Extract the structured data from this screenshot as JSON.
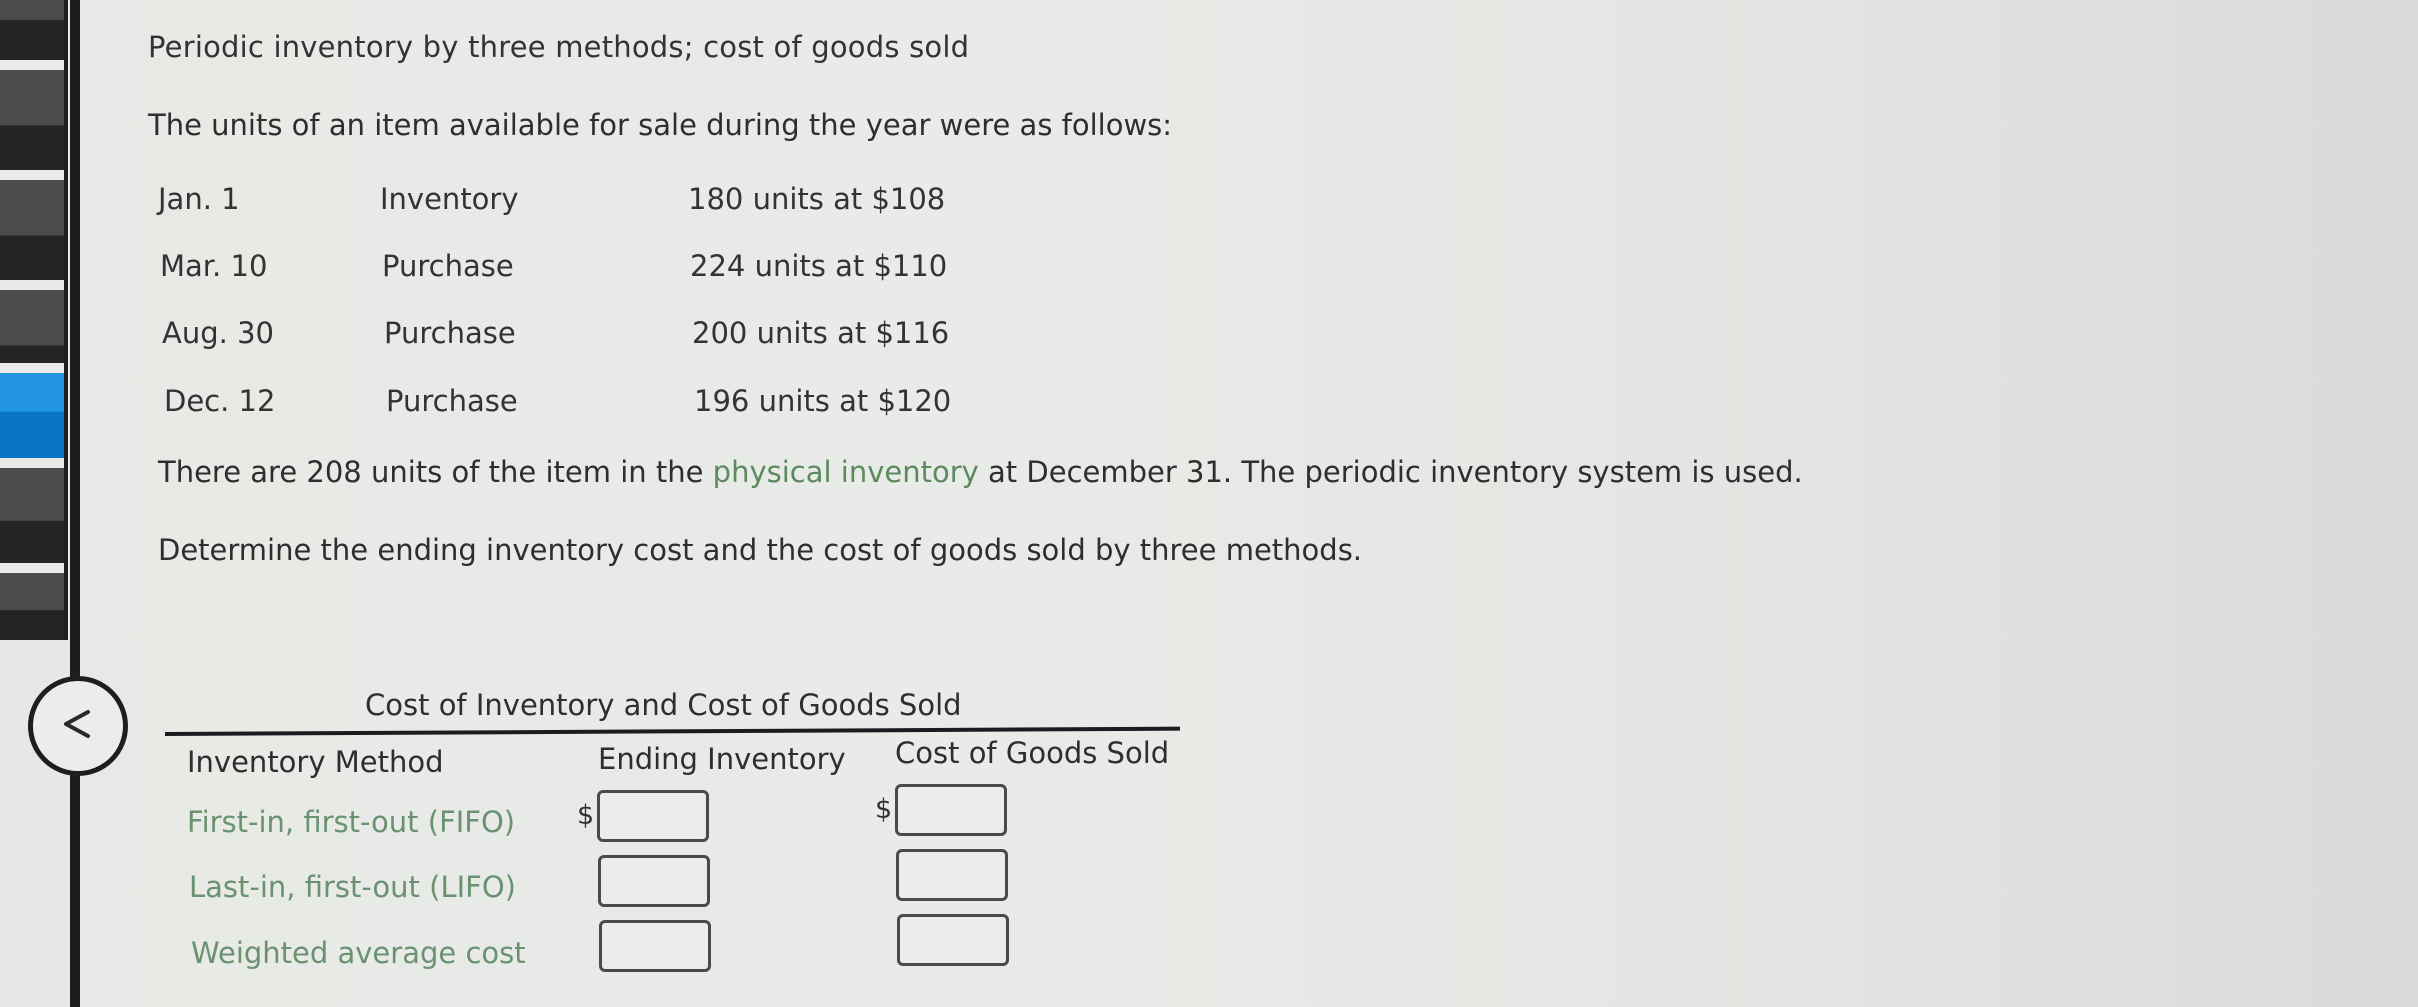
{
  "nav": {
    "tabs_count": 6,
    "active_tab_index": 3,
    "accent_color": "#2194e0",
    "collapse_icon": "chevron-left-icon"
  },
  "problem": {
    "title": "Periodic inventory by three methods; cost of goods sold",
    "intro": "The units of an item available for sale during the year were as follows:",
    "lots": [
      {
        "date": "Jan. 1",
        "type": "Inventory",
        "quantity": "180 units at $108"
      },
      {
        "date": "Mar. 10",
        "type": "Purchase",
        "quantity": "224 units at $110"
      },
      {
        "date": "Aug. 30",
        "type": "Purchase",
        "quantity": "200 units at $116"
      },
      {
        "date": "Dec. 12",
        "type": "Purchase",
        "quantity": "196 units at $120"
      }
    ],
    "physical_before": "There are 208 units of the item in the ",
    "physical_link": "physical inventory",
    "physical_after": " at December 31. The periodic inventory system is used.",
    "instruction": "Determine the ending inventory cost and the cost of goods sold by three methods.",
    "link_color": "#5d8a5d"
  },
  "answer_table": {
    "caption": "Cost of Inventory and Cost of Goods Sold",
    "headers": {
      "method": "Inventory Method",
      "ending_inventory": "Ending Inventory",
      "cogs": "Cost of Goods Sold"
    },
    "currency_symbol": "$",
    "rows": [
      {
        "method": "First-in, first-out (FIFO)",
        "ending_inventory": "",
        "cogs": ""
      },
      {
        "method": "Last-in, first-out (LIFO)",
        "ending_inventory": "",
        "cogs": ""
      },
      {
        "method": "Weighted average cost",
        "ending_inventory": "",
        "cogs": ""
      }
    ],
    "label_color": "#6b9270"
  }
}
